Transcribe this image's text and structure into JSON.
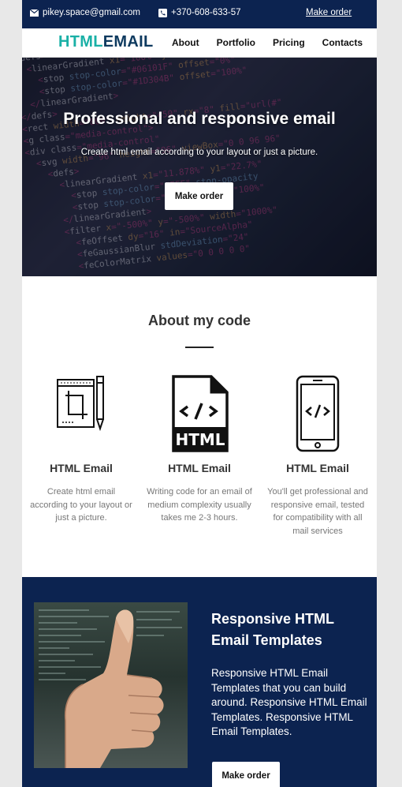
{
  "topbar": {
    "email": "pikey.space@gmail.com",
    "phone": "+370-608-633-57",
    "order_link": "Make order"
  },
  "nav": {
    "logo_part1": "HTML",
    "logo_part2": "EMAIL",
    "items": [
      "About",
      "Portfolio",
      "Pricing",
      "Contacts"
    ]
  },
  "hero": {
    "title": "Professional and responsive email",
    "subtitle": "Create html email according to your layout or just a picture.",
    "button": "Make order"
  },
  "about": {
    "heading": "About my code",
    "features": [
      {
        "icon": "design-tools-icon",
        "title": "HTML Email",
        "text": "Create html email according to your layout or just a picture."
      },
      {
        "icon": "html-file-icon",
        "title": "HTML Email",
        "text": "Writing code for an email of medium complexity usually takes me 2-3 hours."
      },
      {
        "icon": "mobile-code-icon",
        "title": "HTML Email",
        "text": "You'll get professional and responsive email, tested for compatibility with all mail services"
      }
    ]
  },
  "templates": {
    "title": "Responsive HTML Email Templates",
    "text": "Responsive HTML Email Templates that you can build around. Responsive HTML Email Templates. Responsive HTML Email Templates.",
    "button": "Make order"
  },
  "colors": {
    "navy": "#0c2350",
    "teal": "#1ab0a6",
    "logo_dark": "#0e3a5f"
  }
}
